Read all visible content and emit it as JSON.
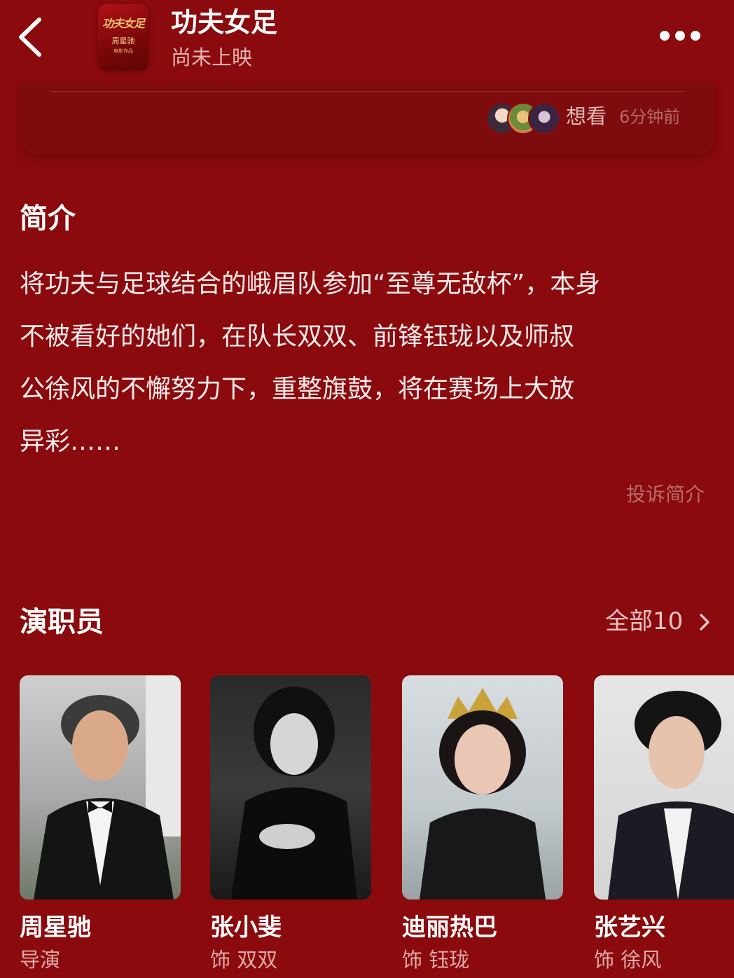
{
  "header": {
    "title": "功夫女足",
    "status": "尚未上映",
    "poster": {
      "title_text": "功夫女足",
      "director_text": "周星驰",
      "subtitle_text": "电影作品"
    }
  },
  "want_to_see": {
    "label": "想看",
    "time": "6分钟前"
  },
  "intro": {
    "title": "简介",
    "lines": [
      "将功夫与足球结合的峨眉队参加“至尊无敌杯”，本身",
      "不被看好的她们，在队长双双、前锋钰珑以及师叔",
      "公徐风的不懈努力下，重整旗鼓，将在赛场上大放",
      "异彩……"
    ],
    "complain_label": "投诉简介"
  },
  "cast": {
    "title": "演职员",
    "all_label": "全部10",
    "members": [
      {
        "name": "周星驰",
        "role": "导演"
      },
      {
        "name": "张小斐",
        "role": "饰 双双"
      },
      {
        "name": "迪丽热巴",
        "role": "饰 钰珑"
      },
      {
        "name": "张艺兴",
        "role": "饰 徐风"
      }
    ]
  },
  "colors": {
    "background": "#8a0a0d",
    "card": "#7e0b0d",
    "muted_text": "#e3a9a9"
  }
}
